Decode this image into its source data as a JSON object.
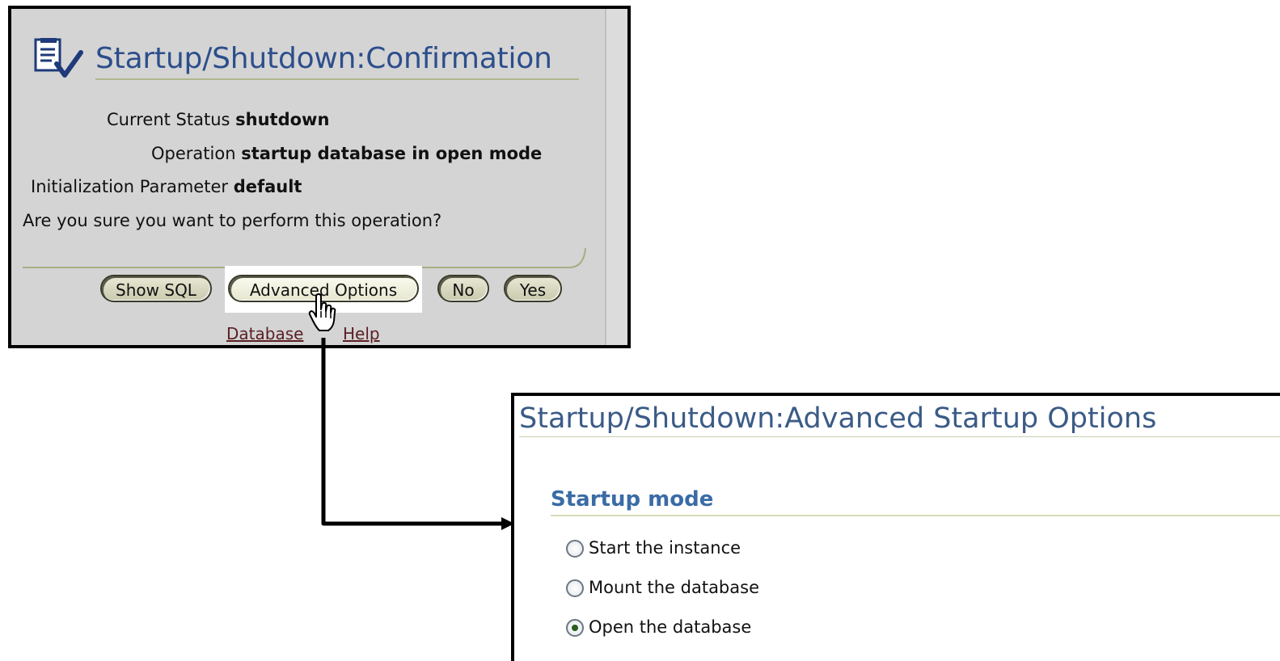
{
  "confirmation": {
    "title": "Startup/Shutdown:Confirmation",
    "current_status_label": "Current Status",
    "current_status_value": "shutdown",
    "operation_label": "Operation",
    "operation_value": "startup database in open mode",
    "init_param_label": "Initialization Parameter",
    "init_param_value": "default",
    "question": "Are you sure you want to perform this operation?",
    "buttons": {
      "show_sql": "Show SQL",
      "advanced_options": "Advanced Options",
      "no": "No",
      "yes": "Yes"
    },
    "links": {
      "database": "Database",
      "separator": "|",
      "help": "Help"
    },
    "icon": "document-check-icon"
  },
  "advanced": {
    "title": "Startup/Shutdown:Advanced Startup Options",
    "section_title": "Startup mode",
    "options": [
      {
        "label": "Start the instance",
        "selected": false
      },
      {
        "label": "Mount the database",
        "selected": false
      },
      {
        "label": "Open the database",
        "selected": true
      }
    ]
  },
  "colors": {
    "title_blue": "#2c4e8c",
    "section_blue": "#3a6ca6",
    "panel_gray": "#d4d4d4",
    "link_maroon": "#5a1f23"
  }
}
